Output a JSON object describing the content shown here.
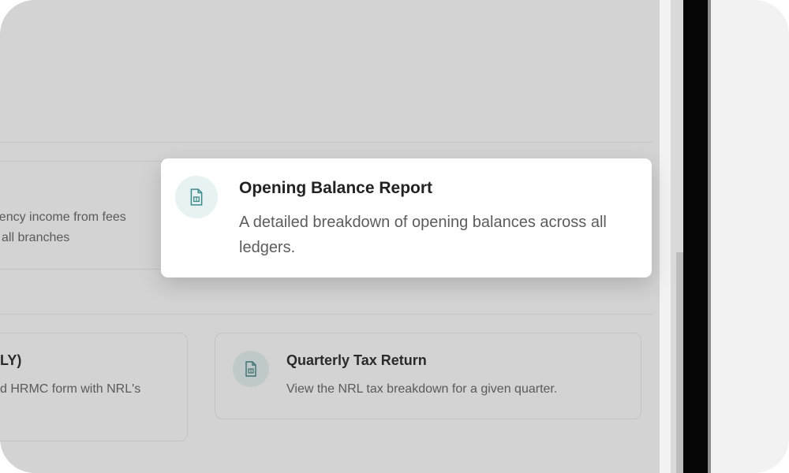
{
  "colors": {
    "overlay": "#d3d3d3",
    "popover_bg": "#ffffff",
    "icon_accent": "#3f8a8a",
    "title_text": "#222222",
    "body_text": "#5c5c5c"
  },
  "popover": {
    "icon": "document-report-icon",
    "title": "Opening Balance Report",
    "description": "A detailed breakdown of opening balances across all ledgers."
  },
  "cards": {
    "partial_top": {
      "line1": "agency income from fees",
      "line2": "all branches"
    },
    "partial_bottom": {
      "title": "LY)",
      "line1": "d HRMC form with NRL's"
    },
    "quarterly": {
      "icon": "document-report-icon",
      "title": "Quarterly Tax Return",
      "description": "View the NRL tax breakdown for a given quarter."
    }
  }
}
